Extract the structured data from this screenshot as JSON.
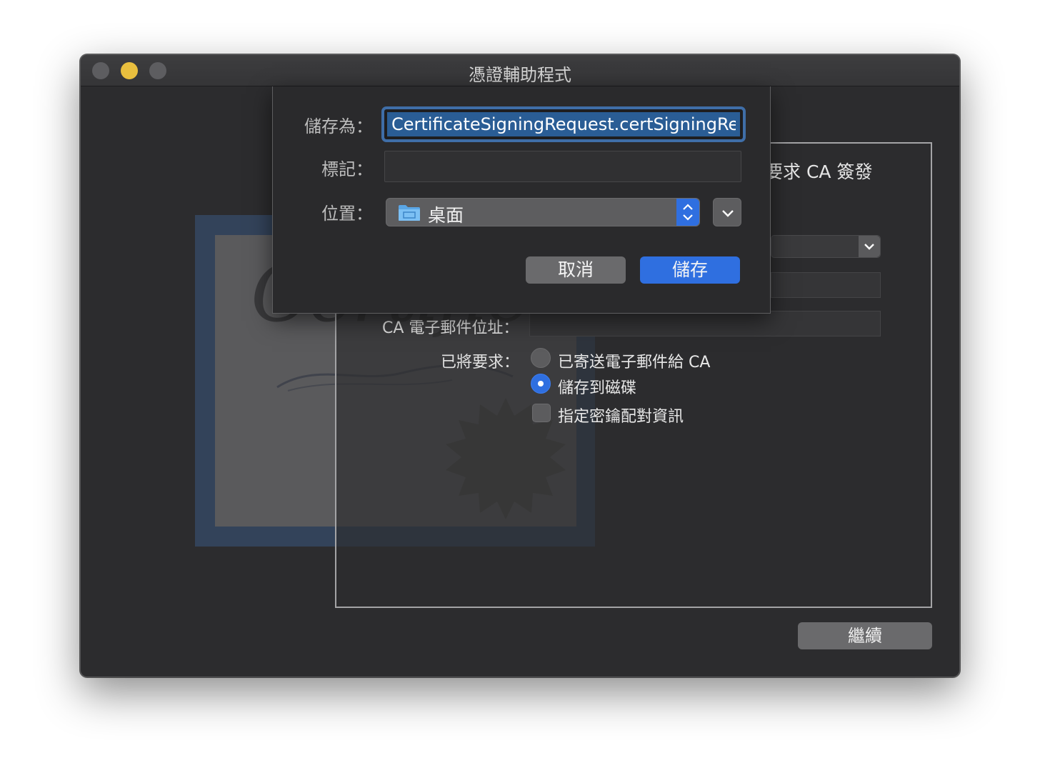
{
  "window": {
    "title": "憑證輔助程式",
    "controls": [
      "close",
      "minimize",
      "zoom"
    ]
  },
  "background_art": {
    "script_text": "Certificate"
  },
  "panel": {
    "heading_partial": "要求 CA 簽發",
    "ca_email_label": "CA 電子郵件位址：",
    "request_label": "已將要求：",
    "options": {
      "emailed": "已寄送電子郵件給 CA",
      "saved_to_disk": "儲存到磁碟",
      "key_pair": "指定密鑰配對資訊"
    },
    "selected_option": "saved_to_disk",
    "continue_label": "繼續"
  },
  "save_sheet": {
    "save_as_label": "儲存為：",
    "filename": "CertificateSigningRequest.certSigningRe",
    "tags_label": "標記：",
    "tags_value": "",
    "location_label": "位置：",
    "location_value": "桌面",
    "location_icon": "folder-icon",
    "cancel_label": "取消",
    "save_label": "儲存"
  },
  "colors": {
    "accent_blue": "#2f6fe0",
    "minimize_yellow": "#e9bf3e",
    "window_bg": "#2c2c2e"
  }
}
